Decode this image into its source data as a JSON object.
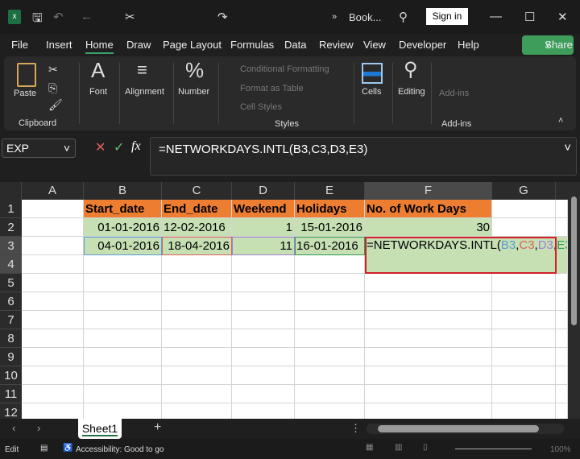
{
  "titlebar": {
    "title": "Book...",
    "sign_in": "Sign in"
  },
  "menu": [
    "File",
    "Insert",
    "Home",
    "Draw",
    "Page Layout",
    "Formulas",
    "Data",
    "Review",
    "View",
    "Developer",
    "Help"
  ],
  "share": "Share",
  "ribbon": {
    "paste": "Paste",
    "clipboard": "Clipboard",
    "font": "Font",
    "alignment": "Alignment",
    "number": "Number",
    "conditional_formatting": "Conditional Formatting",
    "format_as_table": "Format as Table",
    "cell_styles": "Cell Styles",
    "styles": "Styles",
    "cells": "Cells",
    "editing": "Editing",
    "addins_btn": "Add-ins",
    "addins_group": "Add-ins"
  },
  "formula_bar": {
    "name_box": "EXP",
    "formula": "=NETWORKDAYS.INTL(B3,C3,D3,E3)"
  },
  "columns": [
    "A",
    "B",
    "C",
    "D",
    "E",
    "F",
    "G"
  ],
  "rows": [
    "1",
    "2",
    "3",
    "4",
    "5",
    "6",
    "7",
    "8",
    "9",
    "10",
    "11",
    "12"
  ],
  "cells": {
    "headers": [
      "Start_date",
      "End_date",
      "Weekend",
      "Holidays",
      "No. of Work Days"
    ],
    "r2": [
      "01-01-2016",
      "12-02-2016",
      "1",
      "15-01-2016",
      "30"
    ],
    "r3": [
      "04-01-2016",
      "18-04-2016",
      "11",
      "16-01-2016"
    ]
  },
  "edit": {
    "fn": "=NETWORKDAYS.INTL(",
    "b3": "B3",
    "c3": "C3",
    "d3": "D3",
    "e3": "E3",
    "comma": ",",
    "close": ")"
  },
  "sheet_tab": "Sheet1",
  "status": {
    "mode": "Edit",
    "accessibility": "Accessibility: Good to go",
    "zoom": "100%"
  }
}
